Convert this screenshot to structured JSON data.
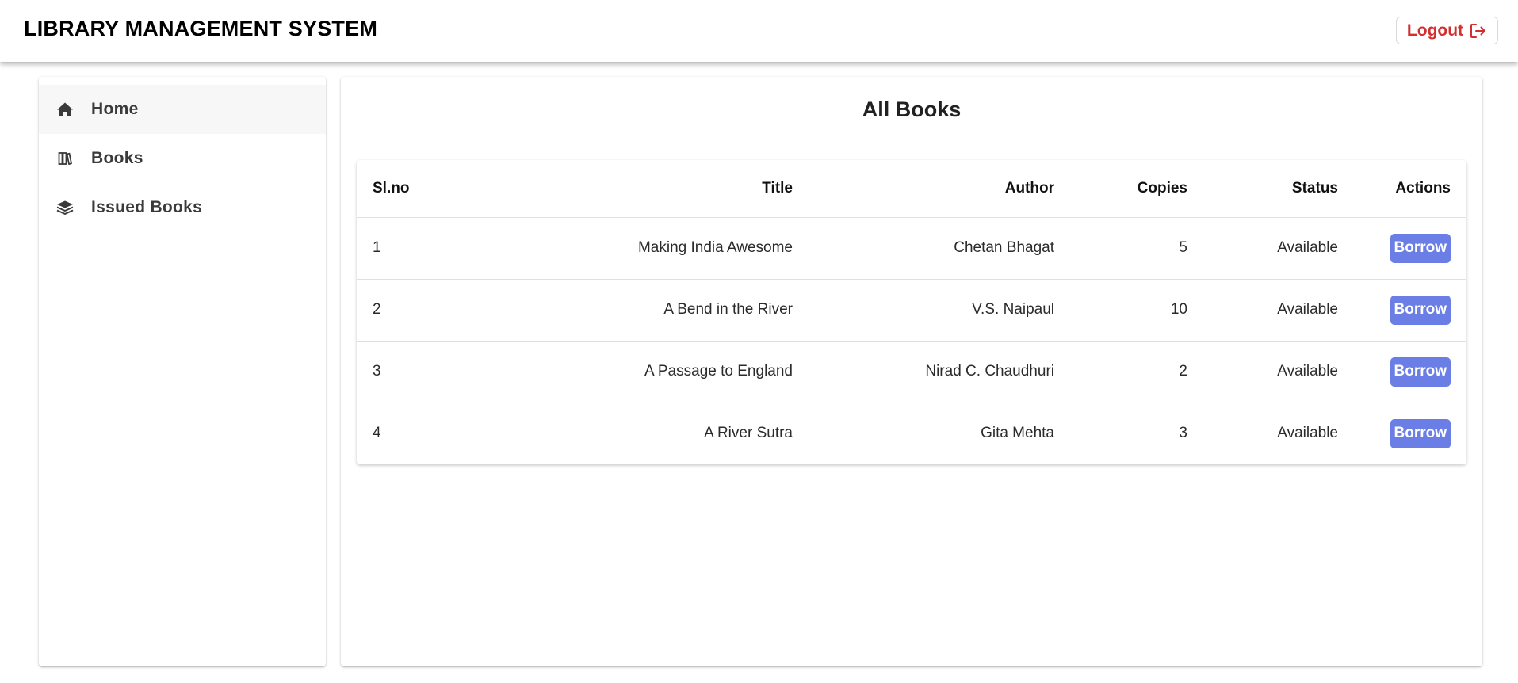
{
  "header": {
    "title": "LIBRARY MANAGEMENT SYSTEM",
    "logout_label": "Logout",
    "logout_color": "#d32f2f"
  },
  "sidebar": {
    "items": [
      {
        "label": "Home",
        "icon": "home-icon",
        "active": true
      },
      {
        "label": "Books",
        "icon": "books-icon",
        "active": false
      },
      {
        "label": "Issued Books",
        "icon": "book-stack-icon",
        "active": false
      }
    ]
  },
  "main": {
    "title": "All Books",
    "table": {
      "columns": [
        "Sl.no",
        "Title",
        "Author",
        "Copies",
        "Status",
        "Actions"
      ],
      "rows": [
        {
          "slno": "1",
          "title": "Making India Awesome",
          "author": "Chetan Bhagat",
          "copies": "5",
          "status": "Available",
          "action": "Borrow"
        },
        {
          "slno": "2",
          "title": "A Bend in the River",
          "author": "V.S. Naipaul",
          "copies": "10",
          "status": "Available",
          "action": "Borrow"
        },
        {
          "slno": "3",
          "title": "A Passage to England",
          "author": "Nirad C. Chaudhuri",
          "copies": "2",
          "status": "Available",
          "action": "Borrow"
        },
        {
          "slno": "4",
          "title": "A River Sutra",
          "author": "Gita Mehta",
          "copies": "3",
          "status": "Available",
          "action": "Borrow"
        }
      ]
    },
    "borrow_button_color": "#6a7ee6"
  }
}
